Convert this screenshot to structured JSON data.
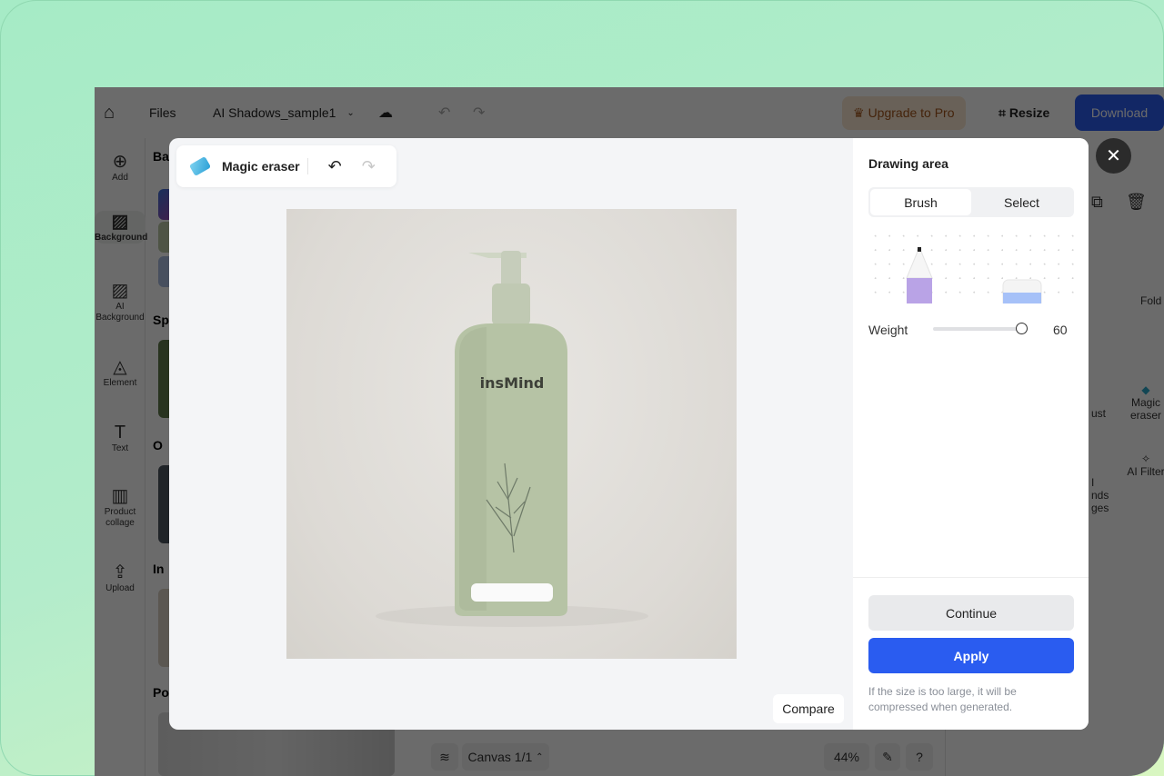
{
  "app": {
    "topbar": {
      "files": "Files",
      "project_name": "AI Shadows_sample1",
      "upgrade": "Upgrade to Pro",
      "resize": "Resize",
      "download": "Download"
    },
    "sidebar": [
      {
        "label": "Add",
        "icon": "plus-circle-icon"
      },
      {
        "label": "Background",
        "icon": "hatch-icon"
      },
      {
        "label": "AI Background",
        "icon": "ai-hatch-icon"
      },
      {
        "label": "Element",
        "icon": "shapes-icon"
      },
      {
        "label": "Text",
        "icon": "text-icon"
      },
      {
        "label": "Product collage",
        "icon": "collage-icon"
      },
      {
        "label": "Upload",
        "icon": "upload-folder-icon"
      }
    ],
    "panel_headings": [
      "Ba",
      "Sp",
      "O",
      "In",
      "Po"
    ],
    "right_panel": {
      "fold": "Fold",
      "tools": [
        {
          "label": "ust"
        },
        {
          "label": "Magic eraser"
        },
        {
          "label": "I\nnds\nges"
        },
        {
          "label": "AI Filter"
        }
      ]
    },
    "bottombar": {
      "canvas": "Canvas 1/1",
      "zoom": "44%",
      "help": "?"
    }
  },
  "modal": {
    "tool_name": "Magic eraser",
    "compare": "Compare",
    "product_brand": "insMind",
    "panel": {
      "title": "Drawing area",
      "modes": [
        "Brush",
        "Select"
      ],
      "active_mode": "Brush",
      "weight_label": "Weight",
      "weight_value": "60",
      "weight_fraction": 0.98,
      "continue": "Continue",
      "apply": "Apply",
      "note": "If the size is too large, it will be compressed when generated."
    },
    "colors": {
      "apply": "#2a5cf0",
      "pencil": "#b9a3e6",
      "eraser": "#a6c1f8"
    }
  }
}
